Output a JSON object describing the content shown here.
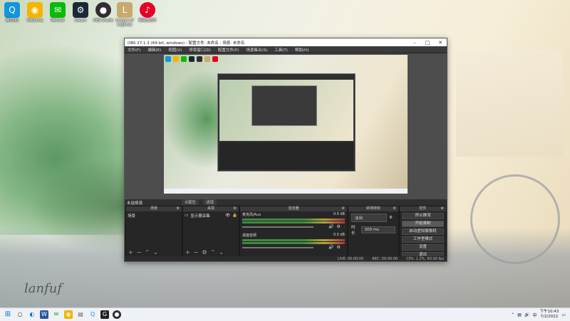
{
  "desktop": {
    "icons": [
      {
        "label": "腾讯QQ",
        "color": "#1296db",
        "glyph": "Q"
      },
      {
        "label": "WeGame",
        "color": "#f4b400",
        "glyph": "◉"
      },
      {
        "label": "WeChat",
        "color": "#09bb07",
        "glyph": "✉"
      },
      {
        "label": "Steam",
        "color": "#1b2838",
        "glyph": "⚙"
      },
      {
        "label": "OBS Studio",
        "color": "#302e31",
        "glyph": "●"
      },
      {
        "label": "League of Legends",
        "color": "#c8aa6e",
        "glyph": "L"
      },
      {
        "label": "网易云音乐",
        "color": "#e60026",
        "glyph": "♪"
      }
    ],
    "signature": "lanfuf"
  },
  "obs": {
    "title": "OBS 27.1.3 (64-bit, windows) - 配置文件: 未命名 - 场景: 未命名",
    "menu": [
      "文件(F)",
      "编辑(E)",
      "视图(V)",
      "停靠窗口(D)",
      "配置文件(P)",
      "场景集合(S)",
      "工具(T)",
      "帮助(H)"
    ],
    "preview_label": "未选择源",
    "tab_properties": "⚙属性",
    "tab_filters": "滤镜",
    "docks": {
      "scenes": {
        "title": "场景",
        "items": [
          "场景"
        ]
      },
      "sources": {
        "title": "来源",
        "items": [
          "显示器采集"
        ]
      },
      "mixer": {
        "title": "混音器",
        "channels": [
          {
            "name": "麦克风/Aux",
            "db": "0.0 dB"
          },
          {
            "name": "桌面音频",
            "db": "0.0 dB"
          }
        ]
      },
      "transitions": {
        "title": "转场特效",
        "type": "淡出",
        "duration_label": "时长",
        "duration": "300 ms"
      },
      "controls": {
        "title": "控件",
        "buttons": [
          "停止推流",
          "开始录制",
          "启动虚拟摄像机",
          "工作室模式",
          "设置",
          "退出"
        ]
      }
    },
    "status": {
      "live": "LIVE: 00:00:00",
      "rec": "REC: 00:00:00",
      "cpu": "CPU: 1.2%, 60.00 fps"
    }
  },
  "taskbar": {
    "time": "下午10:43",
    "date": "7/2/2022",
    "lang": "中"
  }
}
